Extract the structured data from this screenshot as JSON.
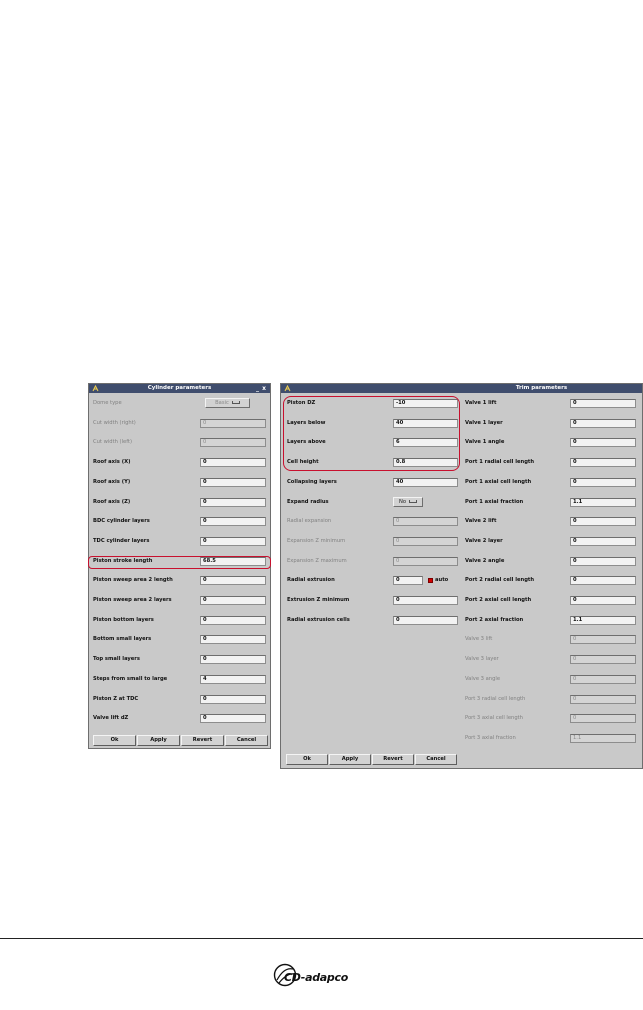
{
  "cylinder": {
    "title": "Cylinder parameters",
    "minimize": "_",
    "close": "x",
    "rows": [
      {
        "label": "Dome type",
        "combo": "Basic",
        "enabled": false
      },
      {
        "label": "Cut width (right)",
        "value": "0",
        "enabled": false
      },
      {
        "label": "Cut width (left)",
        "value": "0",
        "enabled": false
      },
      {
        "label": "Roof axis (X)",
        "value": "0",
        "enabled": true
      },
      {
        "label": "Roof axis (Y)",
        "value": "0",
        "enabled": true
      },
      {
        "label": "Roof axis (Z)",
        "value": "0",
        "enabled": true
      },
      {
        "label": "BDC cylinder layers",
        "value": "0",
        "enabled": true
      },
      {
        "label": "TDC cylinder layers",
        "value": "0",
        "enabled": true
      },
      {
        "label": "Piston stroke length",
        "value": "68.5",
        "enabled": true
      },
      {
        "label": "Piston sweep area 2 length",
        "value": "0",
        "enabled": true
      },
      {
        "label": "Piston sweep area 2 layers",
        "value": "0",
        "enabled": true
      },
      {
        "label": "Piston bottom layers",
        "value": "0",
        "enabled": true
      },
      {
        "label": "Bottom small layers",
        "value": "0",
        "enabled": true
      },
      {
        "label": "Top small layers",
        "value": "0",
        "enabled": true
      },
      {
        "label": "Steps from small to large",
        "value": "4",
        "enabled": true
      },
      {
        "label": "Piston Z at TDC",
        "value": "0",
        "enabled": true
      },
      {
        "label": "Valve lift dZ",
        "value": "0",
        "enabled": true
      }
    ],
    "buttons": {
      "ok": "Ok",
      "apply": "Apply",
      "revert": "Revert",
      "cancel": "Cancel"
    }
  },
  "trim": {
    "title": "Trim parameters",
    "left_rows": [
      {
        "label": "Piston DZ",
        "value": "-10",
        "enabled": true
      },
      {
        "label": "Layers below",
        "value": "40",
        "enabled": true
      },
      {
        "label": "Layers above",
        "value": "6",
        "enabled": true
      },
      {
        "label": "Cell height",
        "value": "0.8",
        "enabled": true
      },
      {
        "label": "Collapsing layers",
        "value": "40",
        "enabled": true
      },
      {
        "label": "Expand radius",
        "combo": "No",
        "enabled": true
      },
      {
        "label": "Radial expansion",
        "value": "0",
        "enabled": false
      },
      {
        "label": "Expansion Z minimum",
        "value": "0",
        "enabled": false
      },
      {
        "label": "Expansion Z maximum",
        "value": "0",
        "enabled": false
      },
      {
        "label": "Radial extrusion",
        "value": "0",
        "enabled": true,
        "check": "auto"
      },
      {
        "label": "Extrusion Z minimum",
        "value": "0",
        "enabled": true
      },
      {
        "label": "Radial extrusion cells",
        "value": "0",
        "enabled": true
      }
    ],
    "right_rows": [
      {
        "label": "Valve 1 lift",
        "value": "0",
        "enabled": true
      },
      {
        "label": "Valve 1 layer",
        "value": "0",
        "enabled": true
      },
      {
        "label": "Valve 1 angle",
        "value": "0",
        "enabled": true
      },
      {
        "label": "Port 1 radial cell length",
        "value": "0",
        "enabled": true
      },
      {
        "label": "Port 1 axial cell length",
        "value": "0",
        "enabled": true
      },
      {
        "label": "Port 1 axial fraction",
        "value": "1.1",
        "enabled": true
      },
      {
        "label": "Valve 2 lift",
        "value": "0",
        "enabled": true
      },
      {
        "label": "Valve 2 layer",
        "value": "0",
        "enabled": true
      },
      {
        "label": "Valve 2 angle",
        "value": "0",
        "enabled": true
      },
      {
        "label": "Port 2 radial cell length",
        "value": "0",
        "enabled": true
      },
      {
        "label": "Port 2 axial cell length",
        "value": "0",
        "enabled": true
      },
      {
        "label": "Port 2 axial fraction",
        "value": "1.1",
        "enabled": true
      },
      {
        "label": "Valve 3 lift",
        "value": "0",
        "enabled": false
      },
      {
        "label": "Valve 3 layer",
        "value": "0",
        "enabled": false
      },
      {
        "label": "Valve 3 angle",
        "value": "0",
        "enabled": false
      },
      {
        "label": "Port 3 radial cell length",
        "value": "0",
        "enabled": false
      },
      {
        "label": "Port 3 axial cell length",
        "value": "0",
        "enabled": false
      },
      {
        "label": "Port 3 axial fraction",
        "value": "1.1",
        "enabled": false
      }
    ],
    "buttons": {
      "ok": "Ok",
      "apply": "Apply",
      "revert": "Revert",
      "cancel": "Cancel"
    }
  },
  "footer": {
    "brand": "CD-adapco"
  },
  "colors": {
    "highlight": "#c8102e",
    "titlebar": "#3f4d6d",
    "panel": "#c9c9c9"
  }
}
